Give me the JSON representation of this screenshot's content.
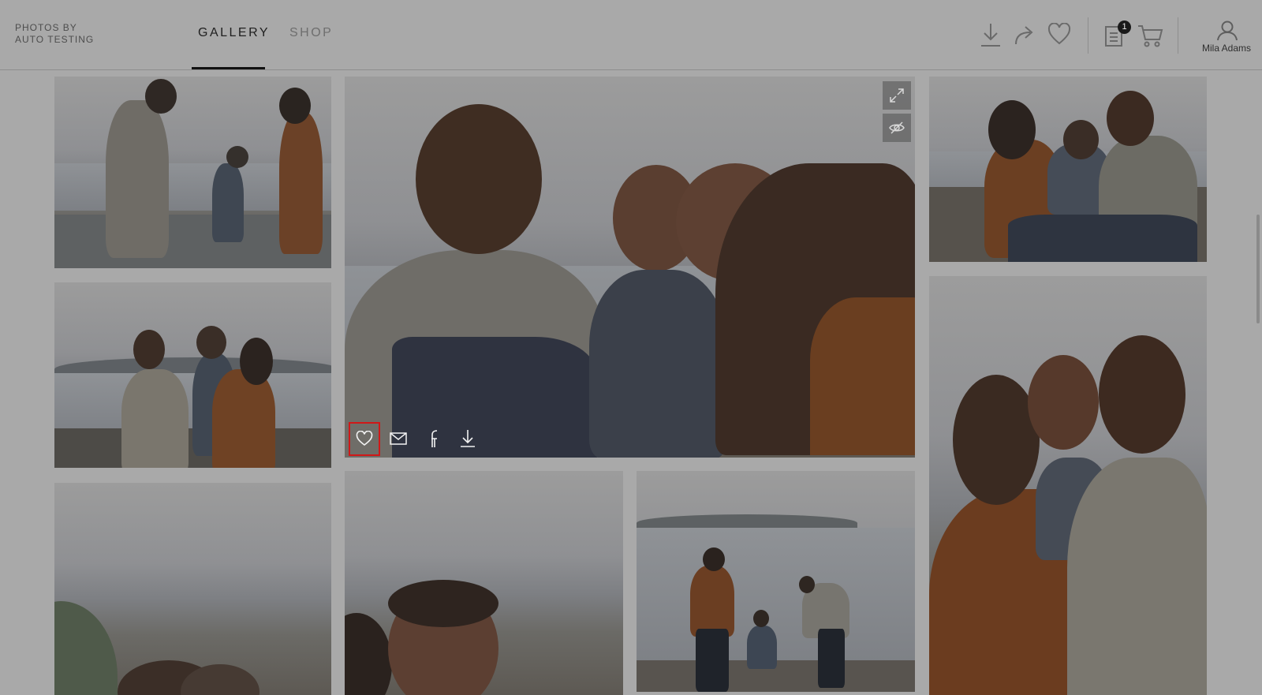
{
  "brand": {
    "line1": "PHOTOS BY",
    "line2": "AUTO TESTING"
  },
  "nav": {
    "tabs": [
      {
        "label": "GALLERY",
        "active": true
      },
      {
        "label": "SHOP",
        "active": false
      }
    ]
  },
  "header_actions": {
    "icons": [
      "download-icon",
      "share-icon",
      "heart-icon",
      "order-list-icon",
      "cart-icon",
      "user-icon"
    ],
    "order_badge": "1",
    "user_name": "Mila Adams"
  },
  "featured_photo": {
    "overlay_icons": [
      "expand-icon",
      "hide-eye-icon"
    ],
    "action_icons": [
      "heart-icon",
      "mail-icon",
      "facebook-icon",
      "download-icon"
    ]
  },
  "colors": {
    "overlay_bg": "#a9a9a9",
    "highlight": "#d01818",
    "text_dark": "#1f1f1f"
  }
}
